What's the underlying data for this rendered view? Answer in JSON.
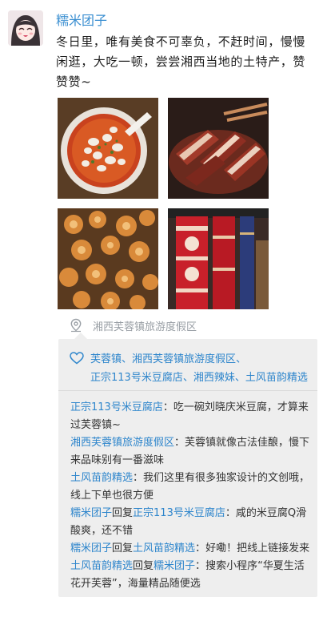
{
  "post": {
    "author": "糯米团子",
    "text": "冬日里，唯有美食不可辜负，不赶时间，慢慢闲逛，大吃一顿，尝尝湘西当地的土特产，赞赞赞~",
    "location": "湘西芙蓉镇旅游度假区",
    "photos": [
      {
        "icon": "rice-tofu-bowl-photo"
      },
      {
        "icon": "cured-meat-photo"
      },
      {
        "icon": "mushrooms-photo"
      },
      {
        "icon": "red-embroidered-fabric-photo"
      }
    ]
  },
  "likes": {
    "line1": "芙蓉镇、湘西芙蓉镇旅游度假区、",
    "line2": "正宗113号米豆腐店、湘西辣妹、土风苗韵精选"
  },
  "comments": [
    {
      "user": "正宗113号米豆腐店",
      "sep": "：",
      "text": "吃一碗刘晓庆米豆腐，才算来过芙蓉镇~"
    },
    {
      "user": "湘西芙蓉镇旅游度假区",
      "sep": "：",
      "text": "芙蓉镇就像古法佳酿，慢下来品味别有一番滋味"
    },
    {
      "user": "土风苗韵精选",
      "sep": "：",
      "text": "我们这里有很多独家设计的文创哦，线上下单也很方便"
    },
    {
      "user": "糯米团子",
      "reply_word": "回复",
      "target": "正宗113号米豆腐店",
      "sep": "：",
      "text": "咸的米豆腐Q滑酸爽，还不错"
    },
    {
      "user": "糯米团子",
      "reply_word": "回复",
      "target": "土风苗韵精选",
      "sep": "：",
      "text": "好嘞！把线上链接发来"
    },
    {
      "user": "土风苗韵精选",
      "reply_word": "回复",
      "target": "糯米团子",
      "sep": "：",
      "text": "搜索小程序“华夏生活花开芙蓉”，海量精品随便选"
    }
  ]
}
